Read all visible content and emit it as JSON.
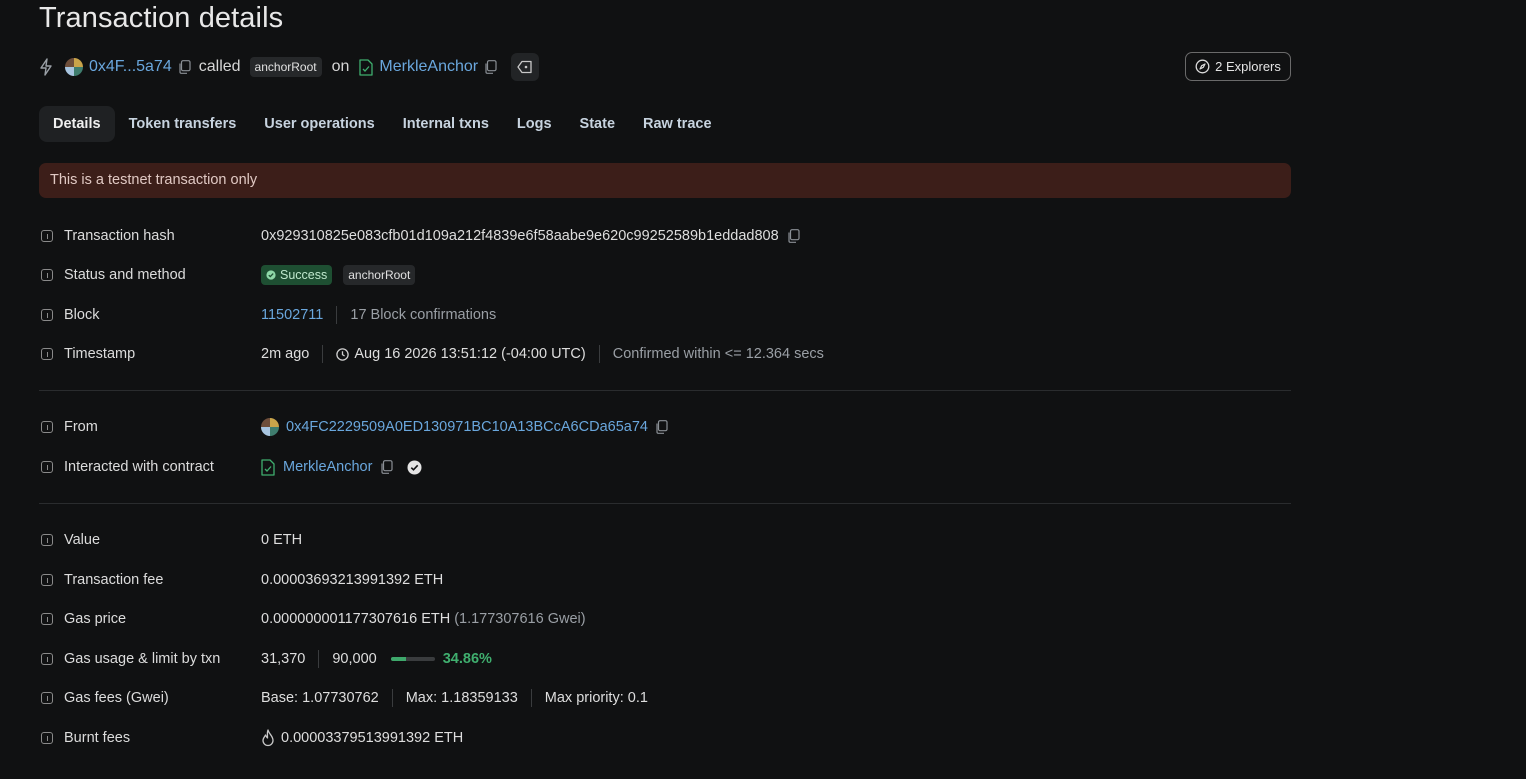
{
  "page": {
    "title": "Transaction details"
  },
  "summary": {
    "from_short": "0x4F...5a74",
    "called_text": "called",
    "method": "anchorRoot",
    "on_text": "on",
    "contract": "MerkleAnchor",
    "explorers_label": "2 Explorers"
  },
  "tabs": [
    "Details",
    "Token transfers",
    "User operations",
    "Internal txns",
    "Logs",
    "State",
    "Raw trace"
  ],
  "banner": "This is a testnet transaction only",
  "details": {
    "tx_hash": {
      "label": "Transaction hash",
      "value": "0x929310825e083cfb01d109a212f4839e6f58aabe9e620c99252589b1eddad808"
    },
    "status": {
      "label": "Status and method",
      "status": "Success",
      "method": "anchorRoot"
    },
    "block": {
      "label": "Block",
      "number": "11502711",
      "confirmations": "17 Block confirmations"
    },
    "timestamp": {
      "label": "Timestamp",
      "relative": "2m ago",
      "absolute": "Aug 16 2026 13:51:12 (-04:00 UTC)",
      "confirmed": "Confirmed within <= 12.364 secs"
    },
    "from": {
      "label": "From",
      "address": "0x4FC2229509A0ED130971BC10A13BCcA6CDa65a74"
    },
    "interacted": {
      "label": "Interacted with contract",
      "contract": "MerkleAnchor"
    },
    "value": {
      "label": "Value",
      "amount": "0",
      "unit": "ETH"
    },
    "tx_fee": {
      "label": "Transaction fee",
      "amount": "0.00003693213991392",
      "unit": "ETH"
    },
    "gas_price": {
      "label": "Gas price",
      "amount": "0.000000001177307616",
      "unit": "ETH",
      "gwei": "(1.177307616 Gwei)"
    },
    "gas_usage": {
      "label": "Gas usage & limit by txn",
      "used": "31,370",
      "limit": "90,000",
      "percent_text": "34.86%",
      "percent": 0.3486
    },
    "gas_fees": {
      "label": "Gas fees (Gwei)",
      "base": "Base: 1.07730762",
      "max": "Max: 1.18359133",
      "max_priority": "Max priority: 0.1"
    },
    "burnt": {
      "label": "Burnt fees",
      "amount": "0.00003379513991392",
      "unit": "ETH"
    }
  },
  "colors": {
    "link": "#6aa7dd",
    "success": "#3fae6e",
    "banner_bg": "#3c1e19"
  }
}
